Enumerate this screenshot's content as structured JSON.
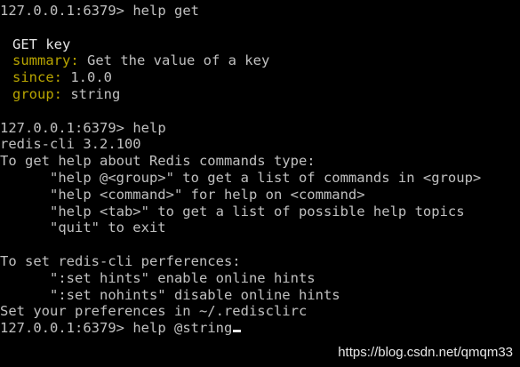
{
  "terminal": {
    "l1_prompt": "127.0.0.1:6379>",
    "l1_cmd": "help get",
    "cmd_name": "GET key",
    "summary_label": "summary:",
    "summary_value": "Get the value of a key",
    "since_label": "since:",
    "since_value": "1.0.0",
    "group_label": "group:",
    "group_value": "string",
    "l2_prompt": "127.0.0.1:6379>",
    "l2_cmd": "help",
    "version": "redis-cli 3.2.100",
    "help_intro": "To get help about Redis commands type:",
    "help_group": "      \"help @<group>\" to get a list of commands in <group>",
    "help_command": "      \"help <command>\" for help on <command>",
    "help_tab": "      \"help <tab>\" to get a list of possible help topics",
    "help_quit": "      \"quit\" to exit",
    "prefs_intro": "To set redis-cli perferences:",
    "pref_hints": "      \":set hints\" enable online hints",
    "pref_nohints": "      \":set nohints\" disable online hints",
    "prefs_file": "Set your preferences in ~/.redisclirc",
    "l3_prompt": "127.0.0.1:6379>",
    "l3_cmd": "help @string"
  },
  "watermark": "https://blog.csdn.net/qmqm33",
  "colors": {
    "background": "#000000",
    "text": "#c0c0c0",
    "label": "#b8a400"
  }
}
